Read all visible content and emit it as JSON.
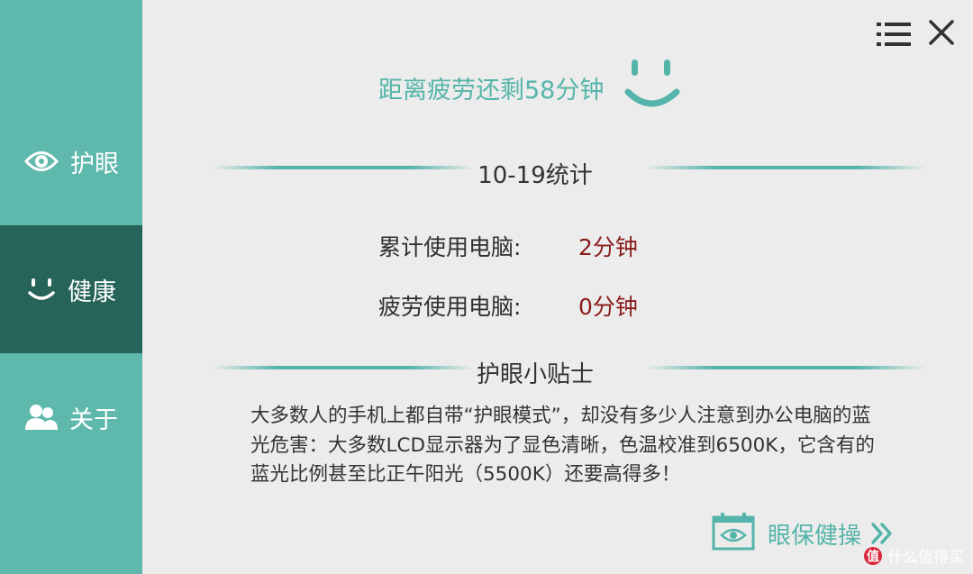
{
  "sidebar": {
    "items": [
      {
        "label": "护眼",
        "icon": "eye-icon",
        "active": false
      },
      {
        "label": "健康",
        "icon": "smile-icon",
        "active": true
      },
      {
        "label": "关于",
        "icon": "users-icon",
        "active": false
      }
    ]
  },
  "header": {
    "menu_icon": "menu-icon",
    "close_icon": "close-icon",
    "countdown_text": "距离疲劳还剩58分钟",
    "status_icon": "smiley-face-icon"
  },
  "stats": {
    "title": "10-19统计",
    "rows": [
      {
        "label": "累计使用电脑:",
        "value": "2分钟"
      },
      {
        "label": "疲劳使用电脑:",
        "value": "0分钟"
      }
    ]
  },
  "tips": {
    "title": "护眼小贴士",
    "text": "大多数人的手机上都自带“护眼模式”，却没有多少人注意到办公电脑的蓝光危害：大多数LCD显示器为了显色清晰，色温校准到6500K，它含有的蓝光比例甚至比正午阳光（5500K）还要高得多！"
  },
  "action": {
    "label": "眼保健操",
    "icon": "calendar-eye-icon",
    "arrow_icon": "double-chevron-right-icon"
  },
  "watermark": {
    "badge": "值",
    "text": "什么值得买"
  },
  "colors": {
    "sidebar": "#5fb8ac",
    "sidebar_active": "#266358",
    "accent": "#54b4aa",
    "value": "#8a1c1c",
    "background": "#ececec"
  }
}
